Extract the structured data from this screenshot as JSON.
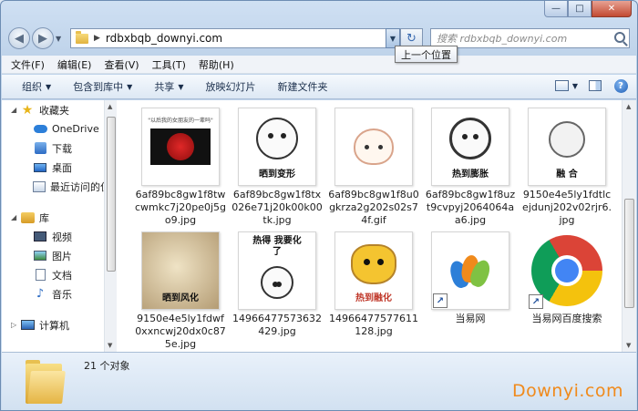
{
  "window": {
    "minimize": "—",
    "maximize": "□",
    "close": "✕"
  },
  "nav": {
    "back": "◀",
    "forward": "▶",
    "address": "rdbxbqb_downyi.com",
    "search_placeholder": "搜索 rdbxbqb_downyi.com",
    "tooltip": "上一个位置"
  },
  "menu": [
    {
      "label": "文件(F)"
    },
    {
      "label": "编辑(E)"
    },
    {
      "label": "查看(V)"
    },
    {
      "label": "工具(T)"
    },
    {
      "label": "帮助(H)"
    }
  ],
  "commands": [
    {
      "label": "组织",
      "has_arrow": true
    },
    {
      "label": "包含到库中",
      "has_arrow": true
    },
    {
      "label": "共享",
      "has_arrow": true
    },
    {
      "label": "放映幻灯片",
      "has_arrow": false
    },
    {
      "label": "新建文件夹",
      "has_arrow": false
    }
  ],
  "sidebar": {
    "favorites": "收藏夹",
    "onedrive": "OneDrive",
    "downloads": "下载",
    "desktop": "桌面",
    "recent": "最近访问的位",
    "libraries": "库",
    "videos": "视频",
    "pictures": "图片",
    "documents": "文档",
    "music": "音乐",
    "computer": "计算机"
  },
  "files": [
    {
      "name": "6af89bc8gw1f8twcwmkc7j20pe0j5go9.jpg",
      "thumb": "rose",
      "caption": "",
      "top_text": "\"以后我的女朋友的一辈吗\""
    },
    {
      "name": "6af89bc8gw1f8tx026e71j20k00k00tk.jpg",
      "thumb": "meme",
      "caption": "晒到变形"
    },
    {
      "name": "6af89bc8gw1f8u0gkrza2g202s02s74f.gif",
      "thumb": "peach",
      "caption": ""
    },
    {
      "name": "6af89bc8gw1f8uzt9cvpyj2064064aa6.jpg",
      "thumb": "meme",
      "caption": "热到膨胀"
    },
    {
      "name": "9150e4e5ly1fdtlcejdunj202v02rjr6.jpg",
      "thumb": "sketch",
      "caption": "融 合"
    },
    {
      "name": "9150e4e5ly1fdwf0xxncwj20dx0c875e.jpg",
      "thumb": "sepia",
      "caption": "晒到风化"
    },
    {
      "name": "14966477573632429.jpg",
      "thumb": "meme",
      "caption": "热得 我要化了"
    },
    {
      "name": "14966477577611128.jpg",
      "thumb": "cat",
      "caption": "热到融化"
    },
    {
      "name": "当易网",
      "thumb": "msn",
      "caption": ""
    },
    {
      "name": "当易网百度搜索",
      "thumb": "chrome",
      "caption": ""
    }
  ],
  "status": {
    "count": "21 个对象"
  },
  "watermark": "Downyi.com",
  "colors": {
    "accent": "#2c7fd9",
    "watermark": "#f08a1c"
  }
}
